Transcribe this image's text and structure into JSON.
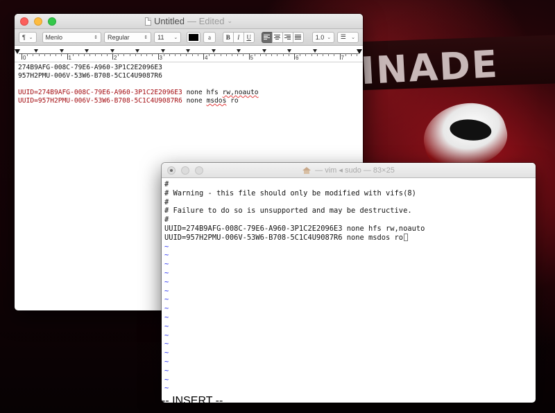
{
  "wallpaper": {
    "logo_text": "INADE"
  },
  "textedit": {
    "title": "Untitled",
    "title_status": "— Edited",
    "toolbar": {
      "paragraph_style": "¶",
      "font_family": "Menlo",
      "font_style": "Regular",
      "font_size": "11",
      "text_color": "#000000",
      "highlight_label": "a",
      "bold_label": "B",
      "italic_label": "I",
      "underline_label": "U",
      "line_spacing": "1.0"
    },
    "ruler_numbers": [
      "0",
      "1",
      "2",
      "3",
      "4",
      "5",
      "6",
      "7"
    ],
    "lines": [
      {
        "text": "274B9AFG-008C-79E6-A960-3P1C2E2096E3"
      },
      {
        "text": "957H2PMU-006V-53W6-B708-5C1C4U9087R6"
      },
      {
        "text": ""
      },
      {
        "pre": "UUID=274B9AFG-008C-79E6-A960-3P1C2E2096E3",
        "mid": " none hfs ",
        "spell": "rw,noauto",
        "post": ""
      },
      {
        "pre": "UUID=957H2PMU-006V-53W6-B708-5C1C4U9087R6",
        "mid": " none ",
        "spell": "msdos",
        "post": " ro"
      }
    ]
  },
  "vim": {
    "title": "— vim ◂ sudo — 83×25",
    "lines": [
      "#",
      "# Warning - this file should only be modified with vifs(8)",
      "#",
      "# Failure to do so is unsupported and may be destructive.",
      "#",
      "UUID=274B9AFG-008C-79E6-A960-3P1C2E2096E3 none hfs rw,noauto",
      "UUID=957H2PMU-006V-53W6-B708-5C1C4U9087R6 none msdos ro"
    ],
    "tilde_char": "~",
    "tilde_count": 17,
    "status_line": "-- INSERT --"
  }
}
